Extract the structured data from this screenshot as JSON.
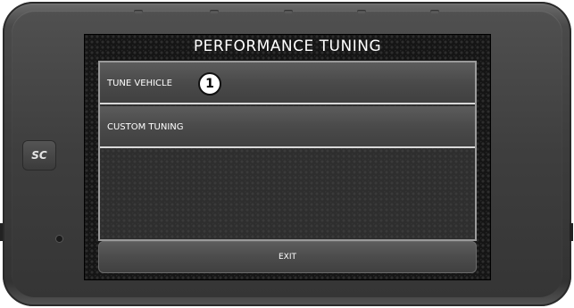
{
  "screen": {
    "title": "PERFORMANCE TUNING",
    "menu_items": [
      {
        "label": "TUNE VEHICLE"
      },
      {
        "label": "CUSTOM TUNING"
      }
    ],
    "callout_number": "1",
    "exit_label": "EXIT"
  },
  "device": {
    "logo_text": "SC"
  },
  "colors": {
    "bezel": "#3c3c3c",
    "screen_bg": "#151515",
    "menu_item": "#4a4a4a",
    "divider": "#d8d8d8",
    "text": "#ffffff"
  }
}
